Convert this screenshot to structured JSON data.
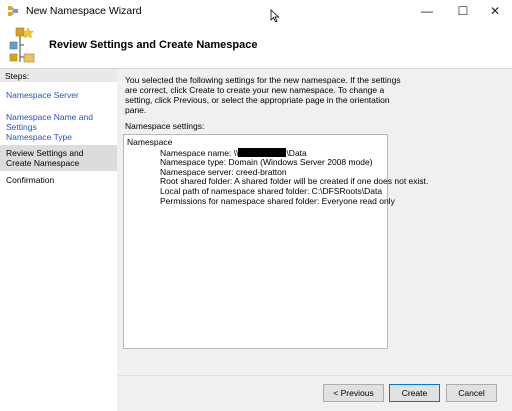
{
  "window": {
    "title": "New Namespace Wizard",
    "controls": {
      "minimize": "—",
      "maximize": "☐",
      "close": "✕"
    }
  },
  "header": {
    "title": "Review Settings and Create Namespace"
  },
  "sidebar": {
    "steps_label": "Steps:",
    "steps": [
      {
        "label": "Namespace Server",
        "state": "link"
      },
      {
        "label": "Namespace Name and Settings",
        "state": "link"
      },
      {
        "label": "Namespace Type",
        "state": "link"
      },
      {
        "label": "Review Settings and Create Namespace",
        "state": "current"
      },
      {
        "label": "Confirmation",
        "state": "plain"
      }
    ]
  },
  "main": {
    "intro": "You selected the following settings for the new namespace. If the settings are correct, click Create to create your new namespace. To change a setting, click Previous, or select the appropriate page in the orientation pane.",
    "settings_label": "Namespace settings:",
    "settings": {
      "heading": "Namespace",
      "name_prefix": "Namespace name: \\\\",
      "name_suffix": "\\Data",
      "type": "Namespace type:  Domain (Windows Server 2008 mode)",
      "server": "Namespace server: creed-bratton",
      "root_folder": "Root shared folder:  A shared folder will be created if one does not exist.",
      "local_path": "Local path of namespace shared folder: C:\\DFSRoots\\Data",
      "permissions": "Permissions for namespace shared folder: Everyone read only"
    }
  },
  "footer": {
    "previous_label": "< Previous",
    "create_label": "Create",
    "cancel_label": "Cancel"
  },
  "colors": {
    "link": "#2952c4",
    "content_bg": "#f0f0f0",
    "focus_border": "#0078d7"
  }
}
